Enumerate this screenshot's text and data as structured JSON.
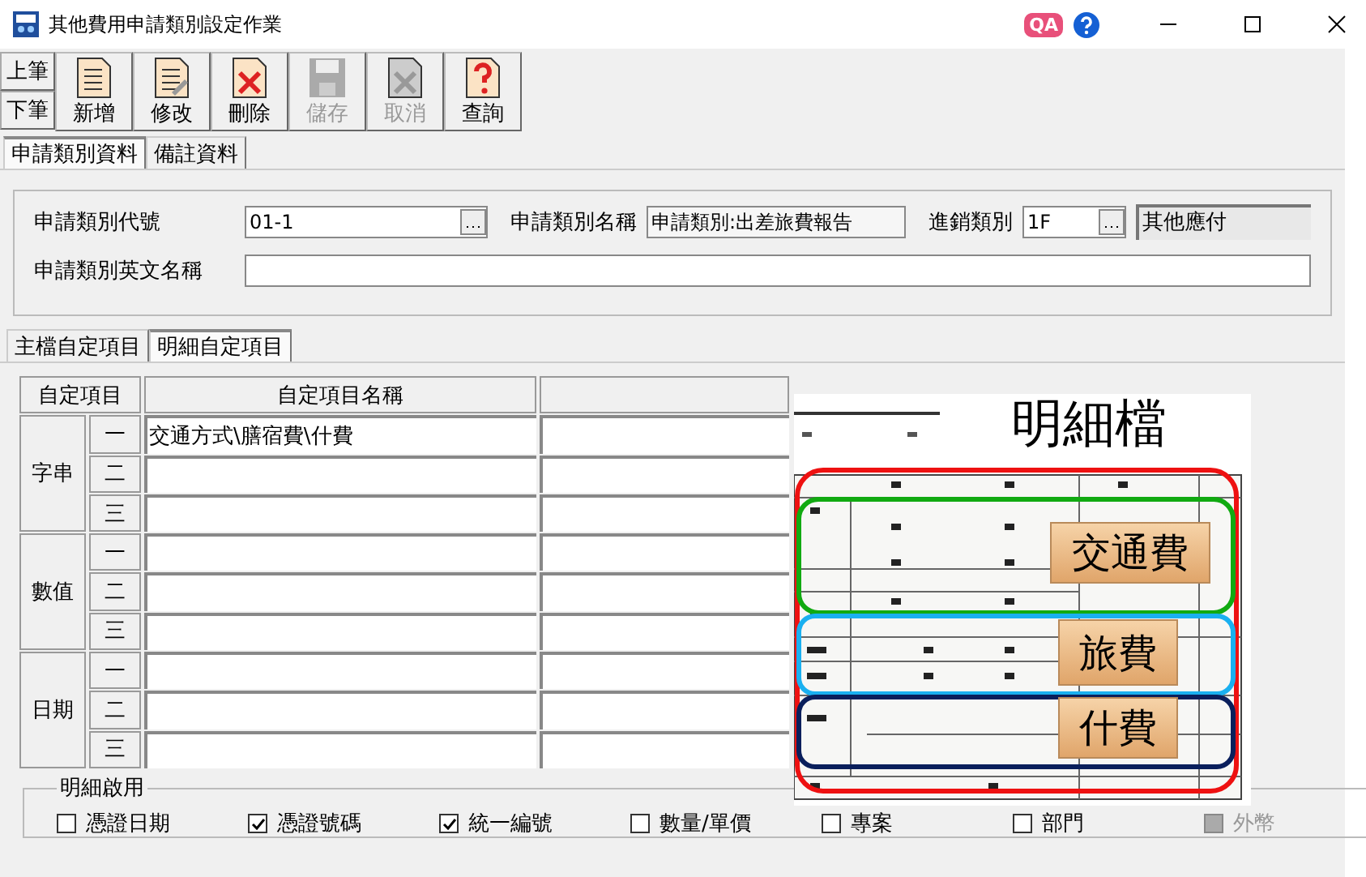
{
  "window": {
    "title": "其他費用申請類別設定作業",
    "qa_badge": "QA"
  },
  "toolbar": {
    "nav": [
      "上筆",
      "下筆"
    ],
    "buttons": [
      {
        "label": "新增",
        "kind": "new",
        "disabled": false
      },
      {
        "label": "修改",
        "kind": "edit",
        "disabled": false
      },
      {
        "label": "刪除",
        "kind": "delete",
        "disabled": false
      },
      {
        "label": "儲存",
        "kind": "save",
        "disabled": true
      },
      {
        "label": "取消",
        "kind": "cancel",
        "disabled": true
      },
      {
        "label": "查詢",
        "kind": "query",
        "disabled": false
      }
    ]
  },
  "tabs": [
    {
      "label": "申請類別資料",
      "selected": true
    },
    {
      "label": "備註資料",
      "selected": false
    }
  ],
  "form": {
    "code_label": "申請類別代號",
    "code_value": "01-1",
    "name_label": "申請類別名稱",
    "name_value": "申請類別:出差旅費報告",
    "writeoff_label": "進銷類別",
    "writeoff_value": "1F",
    "writeoff_desc": "其他應付",
    "english_label": "申請類別英文名稱"
  },
  "subtabs": [
    {
      "label": "主檔自定項目",
      "selected": false
    },
    {
      "label": "明細自定項目",
      "selected": true
    }
  ],
  "grid": {
    "columns": [
      "自定項目",
      "自定項目名稱"
    ],
    "groups": [
      {
        "label": "字串",
        "rows": [
          {
            "index": "一",
            "name": "交通方式\\膳宿費\\什費"
          },
          {
            "index": "二"
          },
          {
            "index": "三"
          }
        ]
      },
      {
        "label": "數值",
        "rows": [
          {
            "index": "一"
          },
          {
            "index": "二"
          },
          {
            "index": "三"
          }
        ]
      },
      {
        "label": "日期",
        "rows": [
          {
            "index": "一"
          },
          {
            "index": "二"
          },
          {
            "index": "三"
          }
        ]
      }
    ]
  },
  "overlay": {
    "kind": "picture",
    "title": "明細檔",
    "labels": [
      "交通費",
      "旅費",
      "什費"
    ]
  },
  "detail_enable": {
    "title": "明細啟用",
    "options": [
      {
        "label": "憑證日期",
        "checked": false,
        "disabled": false
      },
      {
        "label": "憑證號碼",
        "checked": true,
        "disabled": false
      },
      {
        "label": "統一編號",
        "checked": true,
        "disabled": false
      },
      {
        "label": "數量/單價",
        "checked": false,
        "disabled": false
      },
      {
        "label": "專案",
        "checked": false,
        "disabled": false
      },
      {
        "label": "部門",
        "checked": false,
        "disabled": false
      },
      {
        "label": "外幣",
        "checked": false,
        "disabled": true
      }
    ]
  }
}
